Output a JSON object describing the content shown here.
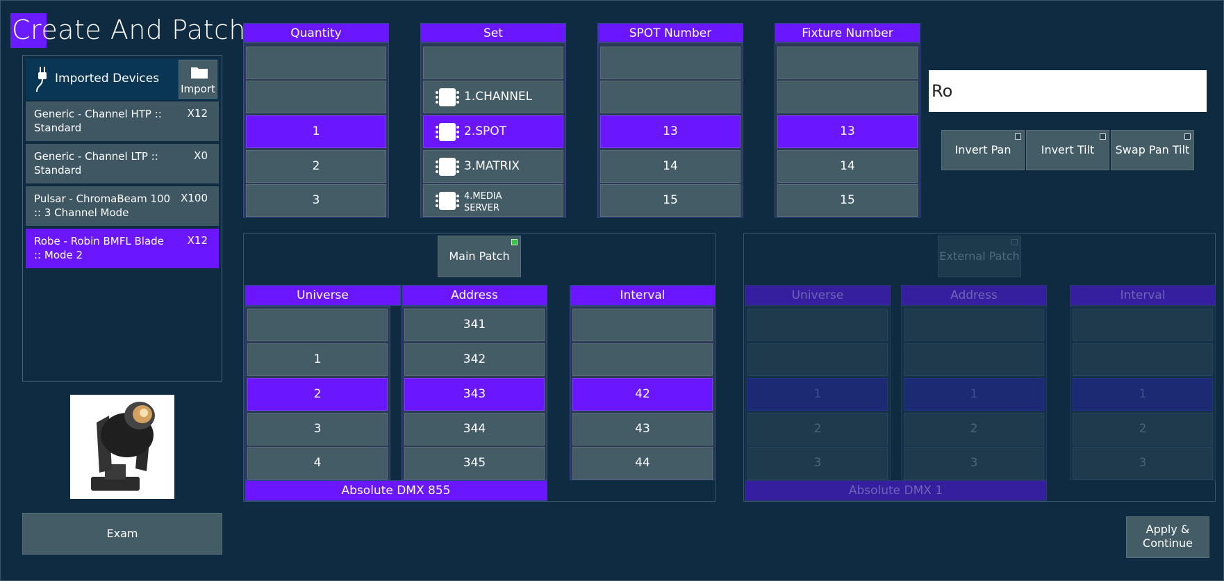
{
  "title": "Create And Patch",
  "devices": {
    "header_label": "Imported Devices",
    "import_label": "Import",
    "items": [
      {
        "name": "Generic - Channel HTP :: Standard",
        "count": "X12"
      },
      {
        "name": "Generic - Channel LTP :: Standard",
        "count": "X0"
      },
      {
        "name": "Pulsar - ChromaBeam 100 :: 3 Channel Mode",
        "count": "X100"
      },
      {
        "name": "Robe - Robin BMFL Blade :: Mode 2",
        "count": "X12"
      }
    ]
  },
  "exam_label": "Exam",
  "columns": {
    "quantity": {
      "header": "Quantity",
      "values": [
        "",
        "",
        "1",
        "2",
        "3"
      ]
    },
    "set": {
      "header": "Set",
      "values": [
        "",
        "1.CHANNEL",
        "2.SPOT",
        "3.MATRIX",
        "4.MEDIA SERVER"
      ]
    },
    "spot_number": {
      "header": "SPOT Number",
      "values": [
        "",
        "",
        "13",
        "14",
        "15"
      ]
    },
    "fixture_number": {
      "header": "Fixture Number",
      "values": [
        "",
        "",
        "13",
        "14",
        "15"
      ]
    }
  },
  "search": {
    "value": "Ro"
  },
  "toggles": {
    "invert_pan": "Invert Pan",
    "invert_tilt": "Invert Tilt",
    "swap_pan_tilt": "Swap Pan Tilt"
  },
  "main_patch": {
    "button_label": "Main Patch",
    "universe": {
      "header": "Universe",
      "values": [
        "",
        "1",
        "2",
        "3",
        "4"
      ]
    },
    "address": {
      "header": "Address",
      "values": [
        "341",
        "342",
        "343",
        "344",
        "345"
      ]
    },
    "interval": {
      "header": "Interval",
      "values": [
        "",
        "",
        "42",
        "43",
        "44"
      ]
    },
    "absolute": "Absolute DMX 855"
  },
  "external_patch": {
    "button_label": "External Patch",
    "universe": {
      "header": "Universe",
      "values": [
        "",
        "",
        "1",
        "2",
        "3"
      ]
    },
    "address": {
      "header": "Address",
      "values": [
        "",
        "",
        "1",
        "2",
        "3"
      ]
    },
    "interval": {
      "header": "Interval",
      "values": [
        "",
        "",
        "1",
        "2",
        "3"
      ]
    },
    "absolute": "Absolute DMX 1"
  },
  "apply_label": "Apply & Continue",
  "colors": {
    "accent": "#6a17ff",
    "background": "#0e2b41",
    "cell": "#445c66"
  }
}
